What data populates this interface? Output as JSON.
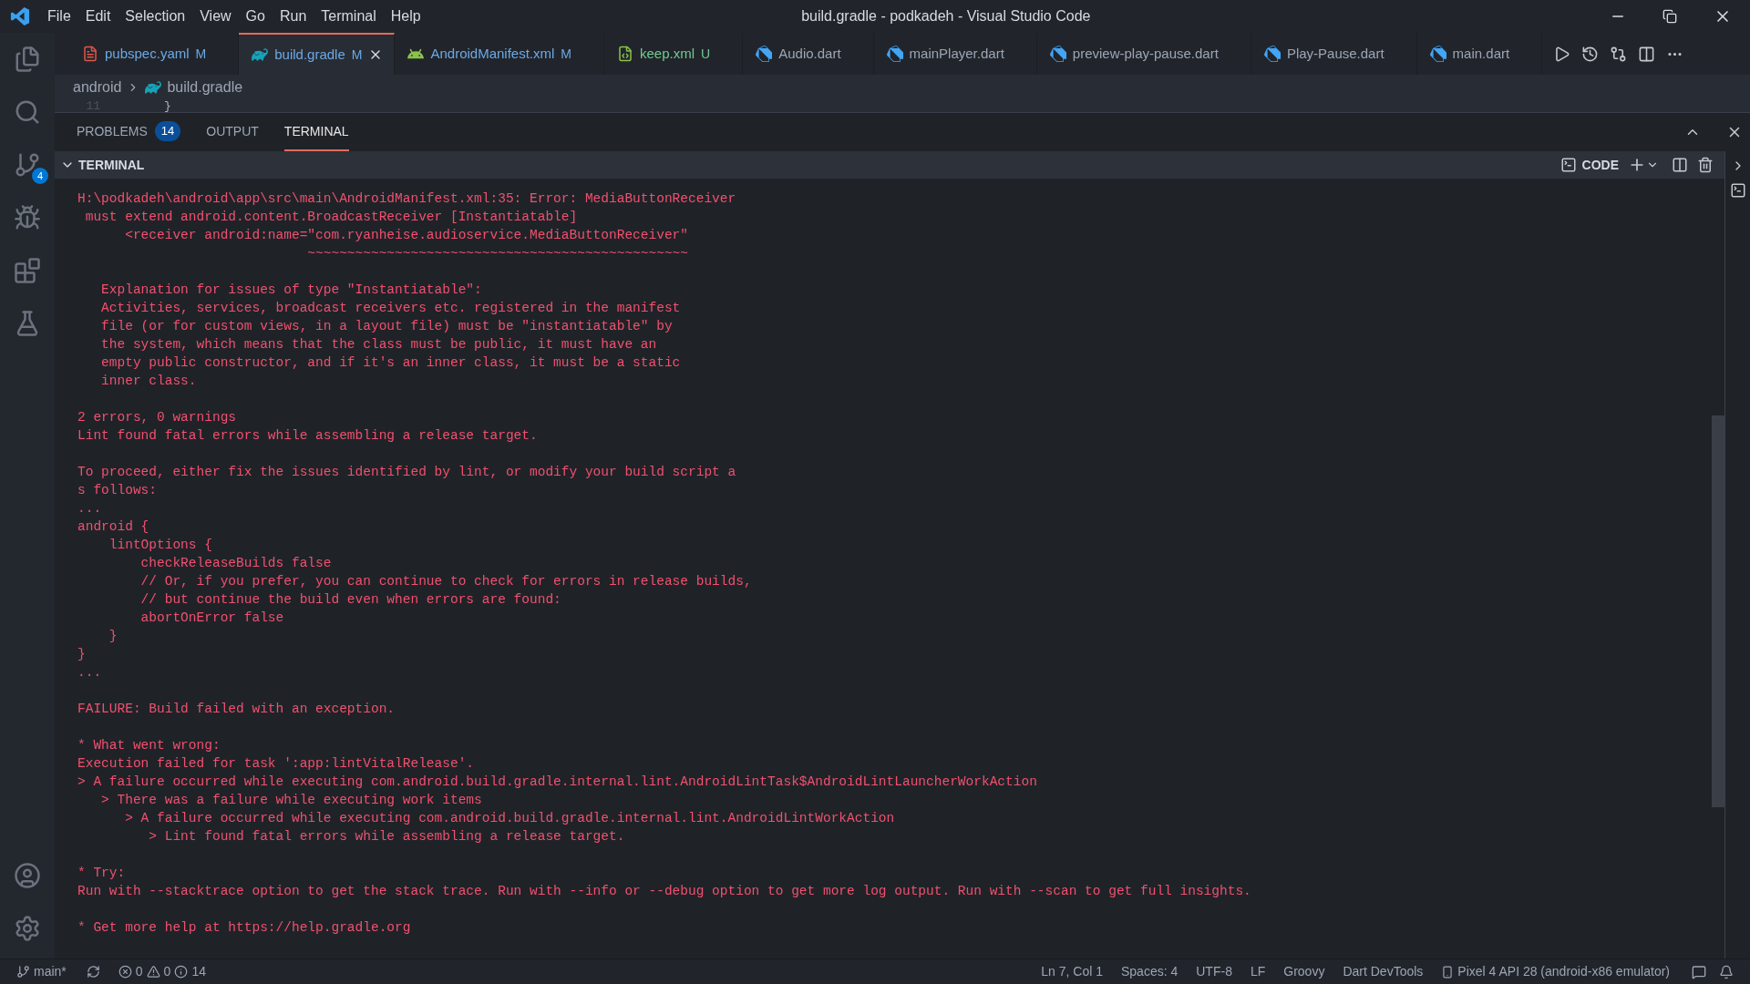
{
  "title_bar": {
    "menu": [
      "File",
      "Edit",
      "Selection",
      "View",
      "Go",
      "Run",
      "Terminal",
      "Help"
    ],
    "title": "build.gradle - podkadeh - Visual Studio Code"
  },
  "activity_bar": {
    "source_control_badge": "4"
  },
  "tabs": [
    {
      "label": "pubspec.yaml",
      "badge": "M",
      "color": "#6ca9e6",
      "kind": "yaml",
      "selected": false
    },
    {
      "label": "build.gradle",
      "badge": "M",
      "color": "#6ca9e6",
      "kind": "gradle",
      "selected": true
    },
    {
      "label": "AndroidManifest.xml",
      "badge": "M",
      "color": "#6ca9e6",
      "kind": "android",
      "selected": false
    },
    {
      "label": "keep.xml",
      "badge": "U",
      "color": "#73c991",
      "kind": "xml",
      "selected": false
    },
    {
      "label": "Audio.dart",
      "kind": "dart",
      "selected": false
    },
    {
      "label": "mainPlayer.dart",
      "kind": "dart",
      "selected": false
    },
    {
      "label": "preview-play-pause.dart",
      "kind": "dart",
      "selected": false
    },
    {
      "label": "Play-Pause.dart",
      "kind": "dart",
      "selected": false
    },
    {
      "label": "main.dart",
      "kind": "dart",
      "selected": false
    }
  ],
  "breadcrumb": [
    "android",
    "build.gradle"
  ],
  "editor": {
    "line_number": "11",
    "line_text": "}"
  },
  "panel": {
    "tabs": [
      {
        "label": "PROBLEMS",
        "count": "14",
        "selected": false
      },
      {
        "label": "OUTPUT",
        "selected": false
      },
      {
        "label": "TERMINAL",
        "selected": true
      }
    ],
    "section": {
      "title": "TERMINAL",
      "expanded": true,
      "profile": "CODE"
    },
    "terminal_blocks": [
      [
        "H:\\podkadeh\\android\\app\\src\\main\\AndroidManifest.xml:35: Error: MediaButtonReceiver",
        " must extend android.content.BroadcastReceiver [Instantiatable]",
        "      <receiver android:name=\"com.ryanheise.audioservice.MediaButtonReceiver\"",
        "                             ~~~~~~~~~~~~~~~~~~~~~~~~~~~~~~~~~~~~~~~~~~~~~~~~"
      ],
      [
        "   Explanation for issues of type \"Instantiatable\":",
        "   Activities, services, broadcast receivers etc. registered in the manifest",
        "   file (or for custom views, in a layout file) must be \"instantiatable\" by",
        "   the system, which means that the class must be public, it must have an",
        "   empty public constructor, and if it's an inner class, it must be a static",
        "   inner class."
      ],
      [
        "2 errors, 0 warnings",
        "Lint found fatal errors while assembling a release target."
      ],
      [
        "To proceed, either fix the issues identified by lint, or modify your build script a",
        "s follows:",
        "...",
        "android {",
        "    lintOptions {",
        "        checkReleaseBuilds false",
        "        // Or, if you prefer, you can continue to check for errors in release builds,",
        "        // but continue the build even when errors are found:",
        "        abortOnError false",
        "    }",
        "}",
        "..."
      ],
      [
        "FAILURE: Build failed with an exception."
      ],
      [
        "* What went wrong:",
        "Execution failed for task ':app:lintVitalRelease'.",
        "> A failure occurred while executing com.android.build.gradle.internal.lint.AndroidLintTask$AndroidLintLauncherWorkAction",
        "   > There was a failure while executing work items",
        "      > A failure occurred while executing com.android.build.gradle.internal.lint.AndroidLintWorkAction",
        "         > Lint found fatal errors while assembling a release target."
      ],
      [
        "* Try:",
        "Run with --stacktrace option to get the stack trace. Run with --info or --debug option to get more log output. Run with --scan to get full insights."
      ],
      [
        "* Get more help at https://help.gradle.org"
      ]
    ]
  },
  "status_bar": {
    "branch": "main*",
    "errors": "0",
    "warnings": "0",
    "infos": "14",
    "right": [
      "Ln 7, Col 1",
      "Spaces: 4",
      "UTF-8",
      "LF",
      "Groovy",
      "Dart DevTools"
    ],
    "device": "Pixel 4 API 28 (android-x86 emulator)"
  }
}
